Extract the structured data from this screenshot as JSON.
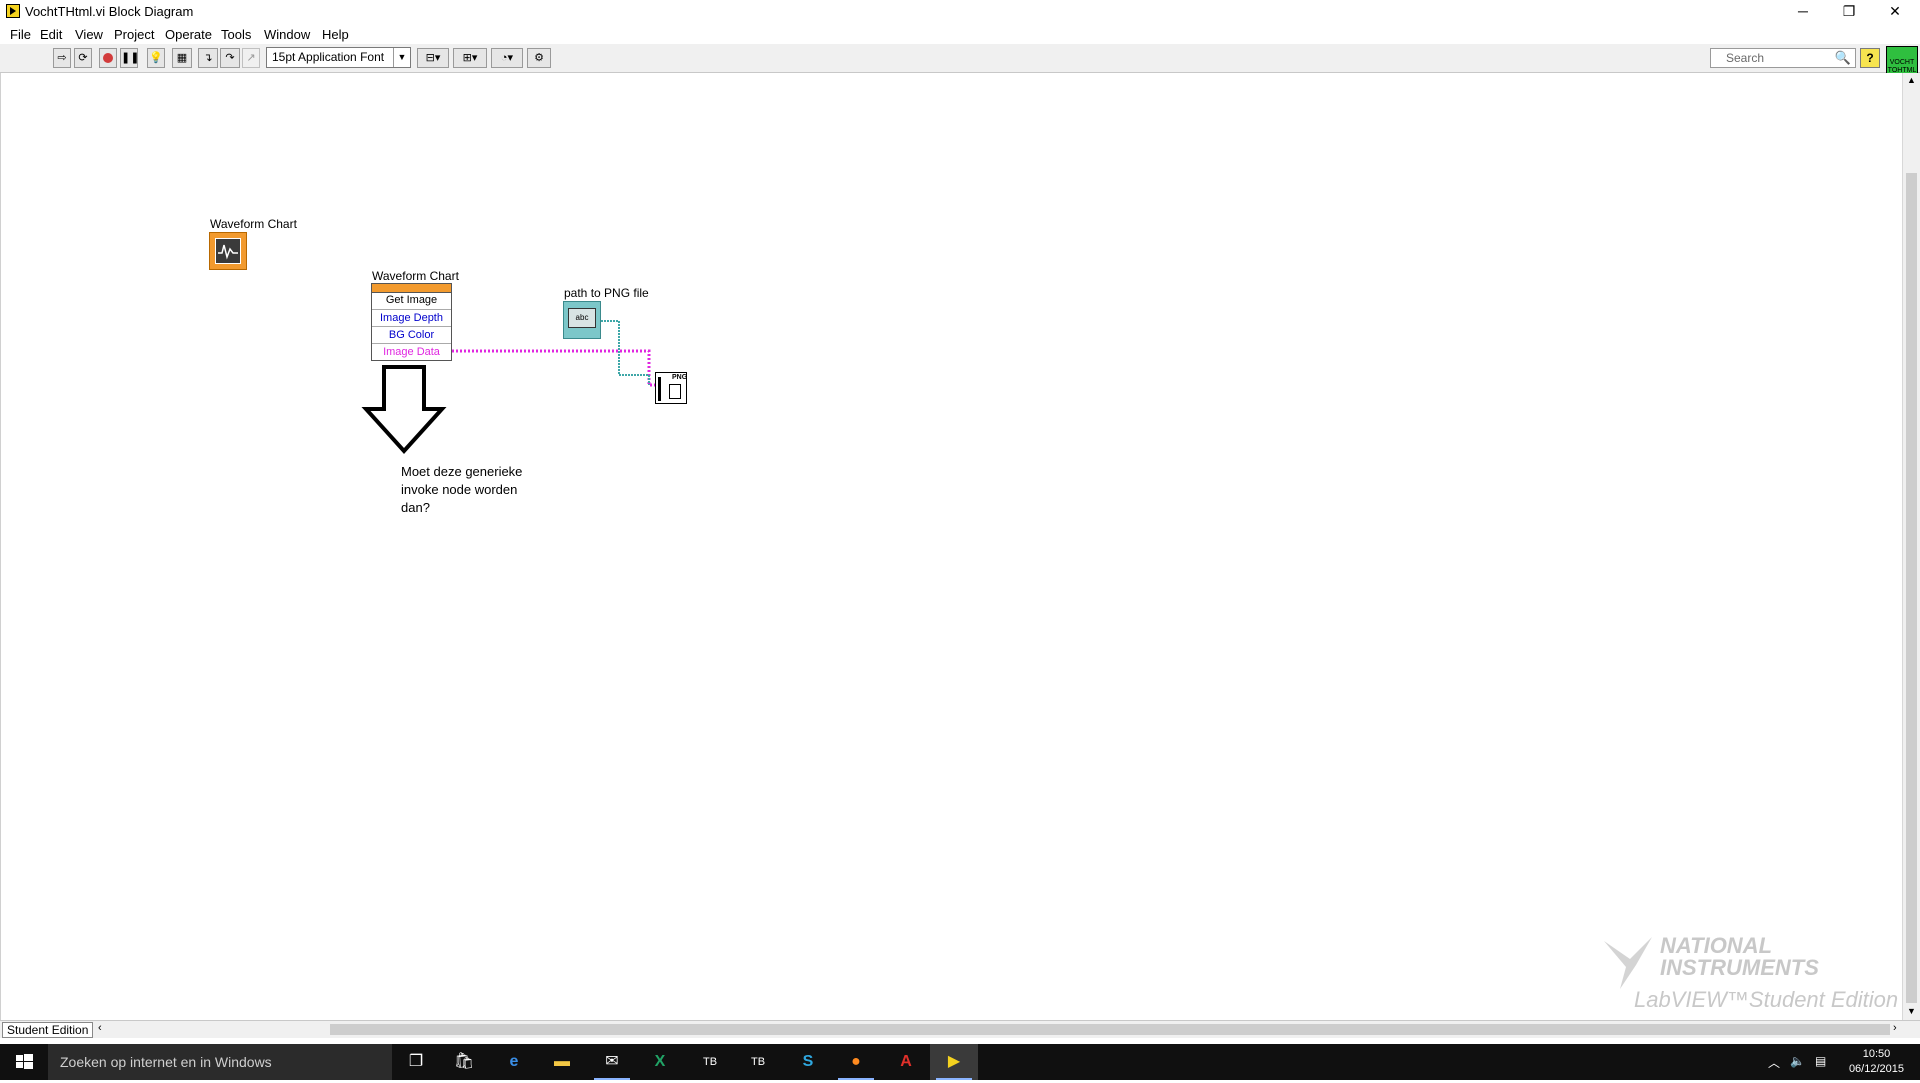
{
  "window": {
    "title": "VochtTHtml.vi Block Diagram",
    "minimize": "─",
    "restore": "❐",
    "close": "✕"
  },
  "menu": [
    "File",
    "Edit",
    "View",
    "Project",
    "Operate",
    "Tools",
    "Window",
    "Help"
  ],
  "toolbar": {
    "font": "15pt Application Font",
    "search_placeholder": "Search",
    "help": "?",
    "vi_icon_text": "VOCHT TOHTML"
  },
  "diagram": {
    "chart_terminal_label": "Waveform Chart",
    "invoke_node": {
      "label": "Waveform Chart",
      "method": "Get Image",
      "params": [
        "Image Depth",
        "BG Color",
        "Image Data"
      ]
    },
    "path_constant_label": "path to PNG file",
    "path_constant_text": "abc",
    "png_vi_text": "PNG",
    "comment": "Moet deze generieke\ninvoke node worden\ndan?"
  },
  "status": {
    "edition_tab": "Student Edition"
  },
  "watermark": {
    "vendor": "NATIONAL\nINSTRUMENTS",
    "product": "LabVIEW™Student Edition"
  },
  "taskbar": {
    "search_placeholder": "Zoeken op internet en in Windows",
    "time": "10:50",
    "date": "06/12/2015"
  },
  "colors": {
    "refnum_orange": "#f29a2e",
    "path_teal": "#3fa7a8",
    "image_wire_pink": "#e027e0",
    "blue_param": "#0000cc"
  }
}
